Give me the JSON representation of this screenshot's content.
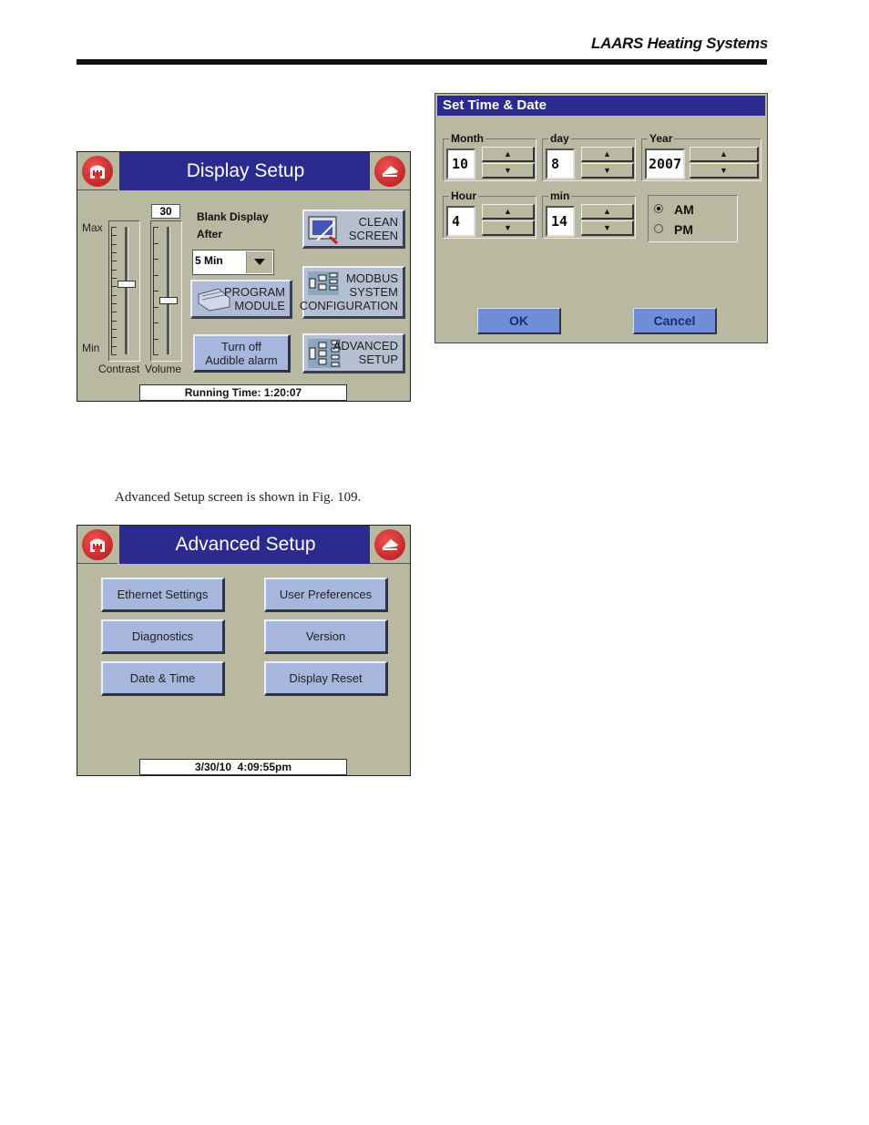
{
  "page": {
    "header_brand": "LAARS Heating Systems",
    "caption": "Advanced Setup screen is shown in Fig. 109."
  },
  "display_setup": {
    "title": "Display Setup",
    "home_icon": "home-building-icon",
    "back_icon": "back-arrow-icon",
    "slider_max_label": "Max",
    "slider_min_label": "Min",
    "contrast_label": "Contrast",
    "volume_label": "Volume",
    "volume_value": "30",
    "contrast_level": 0.55,
    "volume_level": 0.42,
    "blank_display_label_1": "Blank Display",
    "blank_display_label_2": "After",
    "blank_display_selected": "5 Min",
    "buttons": {
      "clean_screen_1": "CLEAN",
      "clean_screen_2": "SCREEN",
      "program_module_1": "PROGRAM",
      "program_module_2": "MODULE",
      "modbus_1": "MODBUS",
      "modbus_2": "SYSTEM",
      "modbus_3": "CONFIGURATION",
      "turn_off_1": "Turn off",
      "turn_off_2": "Audible alarm",
      "advanced_1": "ADVANCED",
      "advanced_2": "SETUP"
    },
    "status": "Running Time: 1:20:07"
  },
  "set_time_date": {
    "title": "Set Time & Date",
    "month_label": "Month",
    "month_value": "10",
    "day_label": "day",
    "day_value": "8",
    "year_label": "Year",
    "year_value": "2007",
    "hour_label": "Hour",
    "hour_value": "4",
    "min_label": "min",
    "min_value": "14",
    "am_label": "AM",
    "pm_label": "PM",
    "selected_period": "AM",
    "up_glyph": "▲",
    "down_glyph": "▼",
    "ok_label": "OK",
    "cancel_label": "Cancel"
  },
  "advanced_setup": {
    "title": "Advanced Setup",
    "buttons": [
      "Ethernet Settings",
      "User Preferences",
      "Diagnostics",
      "Version",
      "Date & Time",
      "Display Reset"
    ],
    "status": "3/30/10  4:09:55pm"
  }
}
